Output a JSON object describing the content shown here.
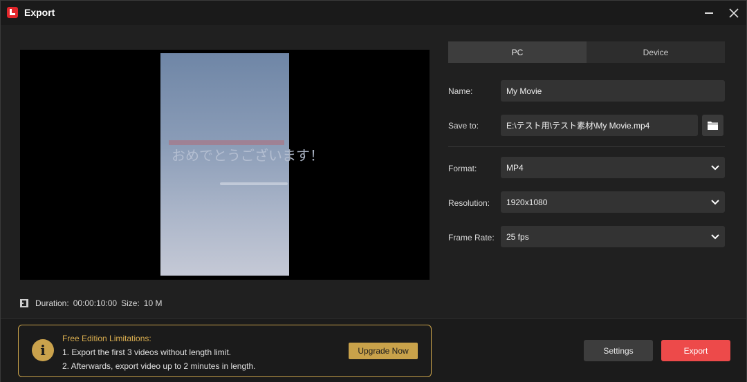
{
  "window": {
    "title": "Export"
  },
  "preview": {
    "overlay_text": "おめでとうございます！",
    "duration_label": "Duration:",
    "duration_value": "00:00:10:00",
    "size_label": "Size:",
    "size_value": "10 M"
  },
  "tabs": [
    {
      "label": "PC",
      "active": true
    },
    {
      "label": "Device",
      "active": false
    }
  ],
  "form": {
    "name_label": "Name:",
    "name_value": "My Movie",
    "save_label": "Save to:",
    "save_value": "E:\\テスト用\\テスト素材\\My Movie.mp4",
    "format_label": "Format:",
    "format_value": "MP4",
    "resolution_label": "Resolution:",
    "resolution_value": "1920x1080",
    "framerate_label": "Frame Rate:",
    "framerate_value": "25 fps"
  },
  "limitations": {
    "title": "Free Edition Limitations:",
    "line1": "1. Export the first 3 videos without length limit.",
    "line2": "2. Afterwards, export video up to 2 minutes in length.",
    "upgrade_label": "Upgrade Now"
  },
  "actions": {
    "settings_label": "Settings",
    "export_label": "Export"
  },
  "colors": {
    "accent_red": "#ed4a4a",
    "accent_gold": "#c9a24a"
  }
}
